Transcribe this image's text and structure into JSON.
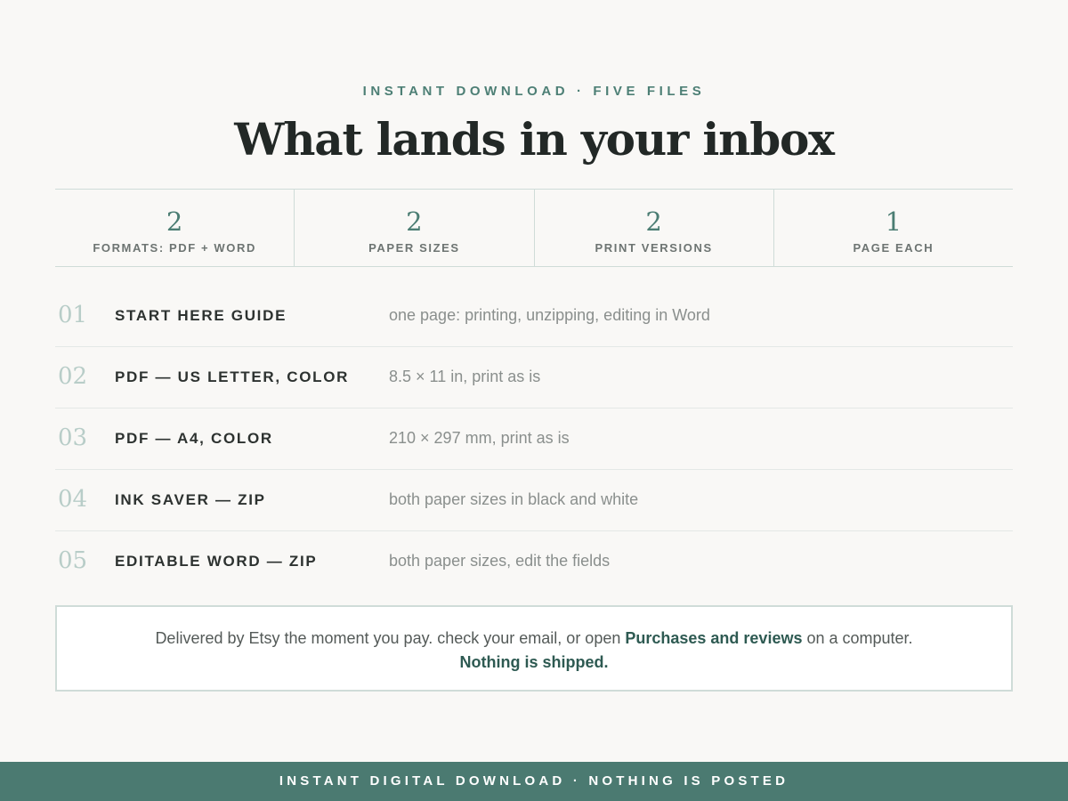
{
  "header": {
    "eyebrow": "INSTANT DOWNLOAD · FIVE FILES",
    "title": "What lands in your inbox"
  },
  "stats": [
    {
      "value": "2",
      "label": "FORMATS: PDF + WORD"
    },
    {
      "value": "2",
      "label": "PAPER SIZES"
    },
    {
      "value": "2",
      "label": "PRINT VERSIONS"
    },
    {
      "value": "1",
      "label": "PAGE EACH"
    }
  ],
  "files": [
    {
      "number": "01",
      "name": "START HERE GUIDE",
      "description": "one page: printing, unzipping, editing in Word"
    },
    {
      "number": "02",
      "name": "PDF — US LETTER, COLOR",
      "description": "8.5 × 11 in, print as is"
    },
    {
      "number": "03",
      "name": "PDF — A4, COLOR",
      "description": "210 × 297 mm, print as is"
    },
    {
      "number": "04",
      "name": "INK SAVER — ZIP",
      "description": "both paper sizes in black and white"
    },
    {
      "number": "05",
      "name": "EDITABLE WORD — ZIP",
      "description": "both paper sizes, edit the fields"
    }
  ],
  "notice": {
    "text_before": "Delivered by Etsy the moment you pay. check your email, or open ",
    "link_text": "Purchases and reviews",
    "text_after": " on a computer.",
    "emphasis": "Nothing is shipped."
  },
  "footer": {
    "text": "INSTANT DIGITAL DOWNLOAD · NOTHING IS POSTED"
  },
  "colors": {
    "accent": "#4b7a71",
    "background": "#f9f8f6",
    "title": "#222826",
    "number_muted": "#b8cdc8"
  }
}
